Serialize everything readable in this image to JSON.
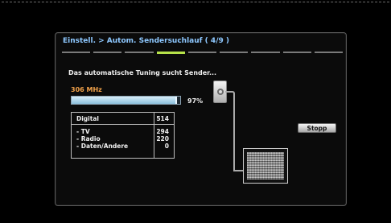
{
  "dialog": {
    "title": "Einstell. > Autom. Sendersuchlauf ( 4/9 )",
    "steps_total": 9,
    "step_current": 4,
    "heading": "Das automatische Tuning sucht Sender...",
    "frequency": "306 MHz",
    "progress_percent": 97,
    "progress_text": "97%",
    "counts": {
      "header": {
        "label": "Digital",
        "value": "514"
      },
      "rows": [
        {
          "label": "- TV",
          "value": "294"
        },
        {
          "label": "- Radio",
          "value": "220"
        },
        {
          "label": "- Daten/Andere",
          "value": "0"
        }
      ]
    },
    "stop_label": "Stopp",
    "colors": {
      "title": "#8ec8ff",
      "frequency": "#f2a24a",
      "active_step": "#b6e24a",
      "progress_fill": "#a8d4ec"
    },
    "icons": [
      "antenna-jack-icon",
      "tv-noise-icon"
    ]
  }
}
